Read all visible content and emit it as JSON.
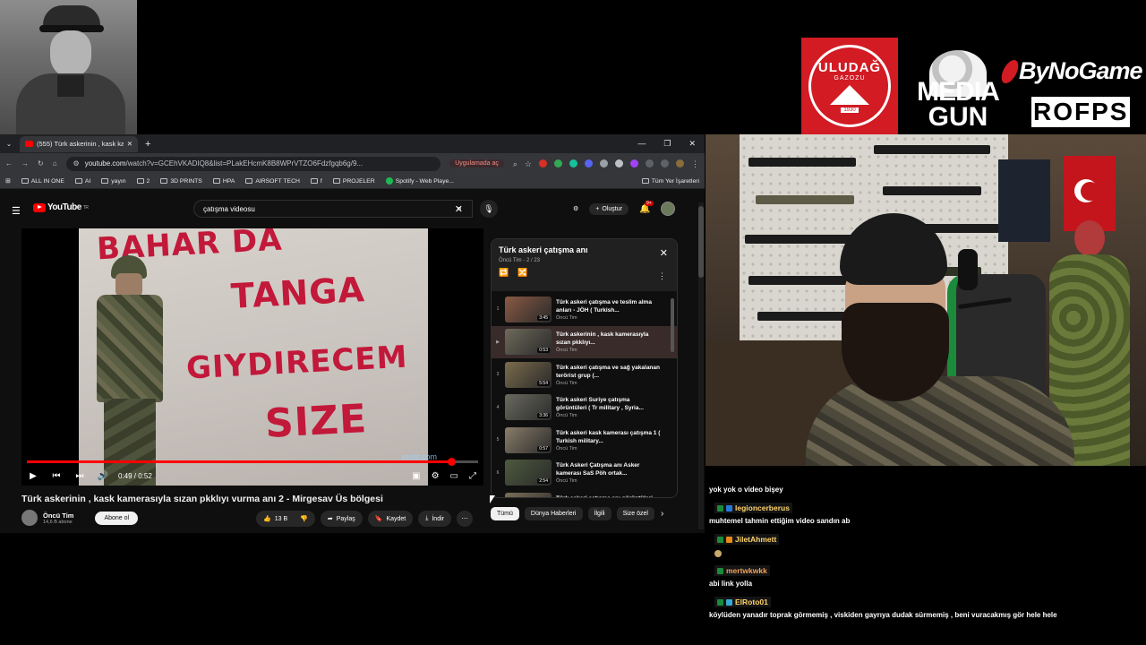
{
  "sponsors": {
    "uludag_name": "ULUDAĞ",
    "uludag_sub": "GAZOZU",
    "uludag_year": "1930",
    "mediagun_line1": "MEDIA",
    "mediagun_line2": "GUN",
    "bynogame": "ByNoGame",
    "rofps": "ROFPS"
  },
  "browser": {
    "tab_title": "(555) Türk askerinin , kask kamerası",
    "url_host": "youtube.com",
    "url_rest": "/watch?v=GCEhVKADIQ8&list=PLakEHcmK8B8WPrVTZO6Fdzfgqb6g/9...",
    "open_in_app": "Uygulamada aç",
    "bookmarks": [
      "ALL IN ONE",
      "AI",
      "yayın",
      "2",
      "3D PRINTS",
      "HPA",
      "AIRSOFT TECH",
      "f",
      "PROJELER",
      "Spotify - Web Playe..."
    ],
    "bookmarks_right": "Tüm Yer İşaretleri"
  },
  "youtube": {
    "logo": "YouTube",
    "logo_region": "TR",
    "search_value": "çatışma videosu",
    "create_label": "Oluştur",
    "notif_count": "9+"
  },
  "video": {
    "graffiti": [
      "BAHAR DA",
      "TANGA",
      "GIYDIRECEM",
      "SIZE"
    ],
    "watermark": "xsolit.com",
    "time": "0:49 / 0:52",
    "progress": 0.94,
    "title": "Türk askerinin , kask kamerasıyla sızan pkklıyı vurma anı 2 - Mirgesav Üs bölgesi",
    "channel": "Öncü Tim",
    "subscribers": "14,6 B abone",
    "subscribe": "Abone ol",
    "likes": "13 B",
    "share": "Paylaş",
    "save": "Kaydet",
    "download": "İndir"
  },
  "playlist": {
    "title": "Türk askeri çatışma anı",
    "sub": "Öncü Tim - 2 / 23",
    "items": [
      {
        "idx": "1",
        "title": "Türk askeri çatışma ve teslim alma anları - JÖH ( Turkish...",
        "channel": "Öncü Tim",
        "dur": "3:45"
      },
      {
        "idx": "▶",
        "title": "Türk askerinin , kask kamerasıyla sızan pkklıyı...",
        "channel": "Öncü Tim",
        "dur": "0:53"
      },
      {
        "idx": "3",
        "title": "Türk askeri çatışma ve sağ yakalanan terörist grup (...",
        "channel": "Öncü Tim",
        "dur": "5:54"
      },
      {
        "idx": "4",
        "title": "Türk askeri Suriye çatışma görüntüleri ( Tr military , Syria...",
        "channel": "Öncü Tim",
        "dur": "3:36"
      },
      {
        "idx": "5",
        "title": "Türk askeri kask kamerası çatışma 1 ( Turkish military...",
        "channel": "Öncü Tim",
        "dur": "0:57"
      },
      {
        "idx": "6",
        "title": "Türk Askeri Çatışma anı Asker kamerası SaS Pöh ortak...",
        "channel": "Öncü Tim",
        "dur": "2:54"
      },
      {
        "idx": "7",
        "title": "Türk askeri çatışma anı görüntüleri - Hakkari'de pkk...",
        "channel": "Öncü Tim",
        "dur": ""
      }
    ]
  },
  "chips": [
    "Tümü",
    "Dünya Haberleri",
    "İlgili",
    "Size özel"
  ],
  "chat": {
    "m1": "yok yok o video bişey",
    "u2": "legioncerberus",
    "m2": "muhtemel tahmin ettiğim video sandın ab",
    "u3": "JiletAhmett",
    "u4": "mertwkwkk",
    "m4": "abi link yolla",
    "u5": "ElRoto01",
    "m5": "köylüden yanadır toprak görmemiş , viskiden gayrıya dudak sürmemiş , beni vuracakmış gör hele hele"
  },
  "colors": {
    "youtube_red": "#ff0000",
    "uludag_red": "#d21b23",
    "accent_green": "#1b8a3a"
  }
}
